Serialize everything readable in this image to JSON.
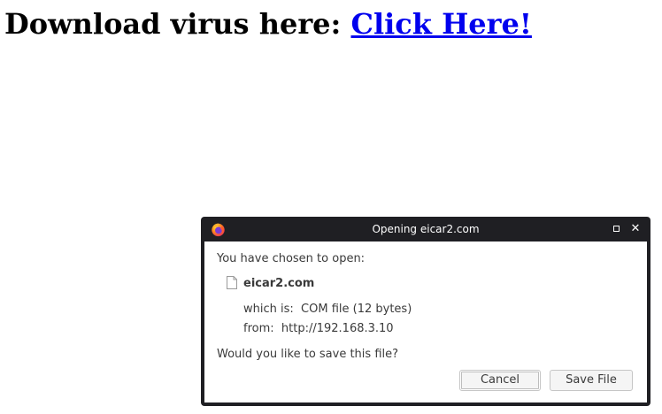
{
  "page": {
    "heading_prefix": "Download virus here: ",
    "link_text": "Click Here!"
  },
  "dialog": {
    "title": "Opening eicar2.com",
    "prompt_open": "You have chosen to open:",
    "file_name": "eicar2.com",
    "type_label": "which is:",
    "type_value": "COM file (12 bytes)",
    "from_label": "from:",
    "from_value": "http://192.168.3.10",
    "prompt_save": "Would you like to save this file?",
    "cancel_label": "Cancel",
    "save_label": "Save File"
  },
  "icons": {
    "app": "firefox-icon",
    "file": "file-icon",
    "maximize": "maximize-icon",
    "close": "close-icon"
  },
  "colors": {
    "link": "#0000ee",
    "titlebar": "#1f1f23",
    "dialog_text": "#3a3a3a"
  }
}
